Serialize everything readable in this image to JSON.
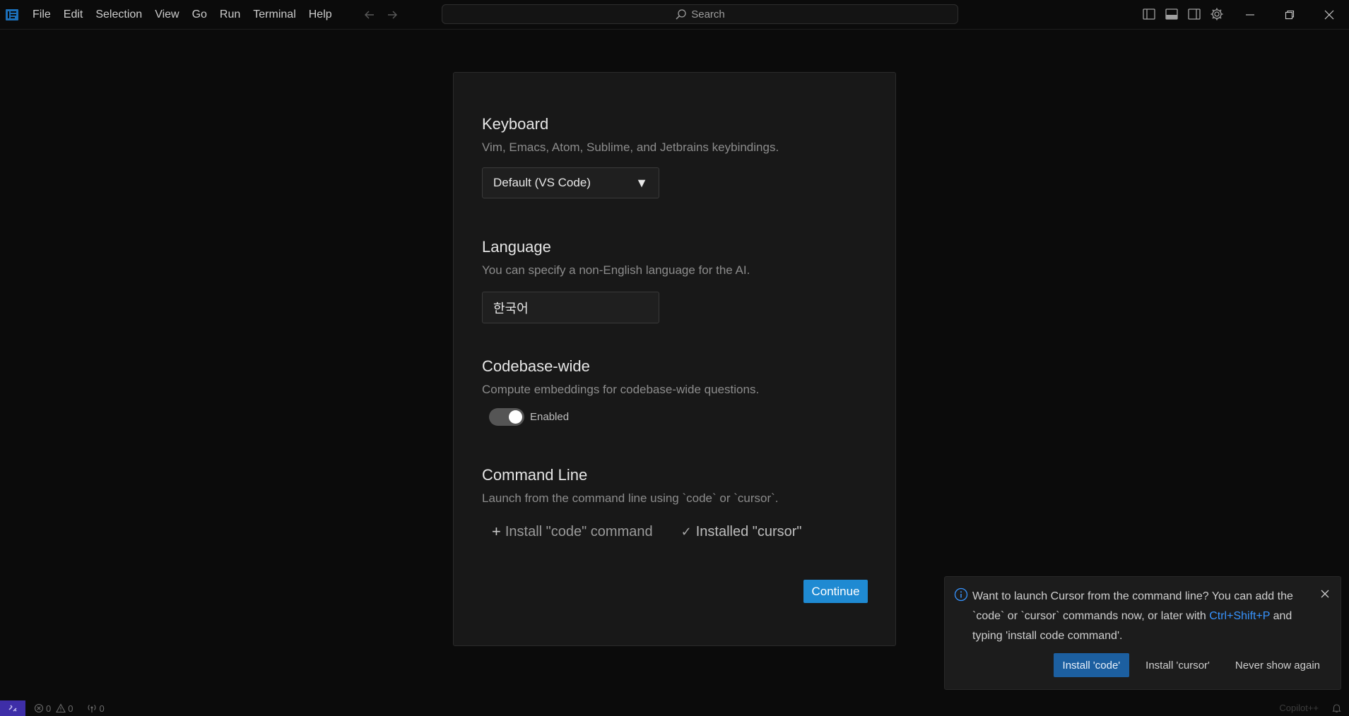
{
  "titlebar": {
    "menu": [
      "File",
      "Edit",
      "Selection",
      "View",
      "Go",
      "Run",
      "Terminal",
      "Help"
    ],
    "search_label": "Search"
  },
  "onboarding": {
    "keyboard": {
      "title": "Keyboard",
      "description": "Vim, Emacs, Atom, Sublime, and Jetbrains keybindings.",
      "selected": "Default (VS Code)"
    },
    "language": {
      "title": "Language",
      "description": "You can specify a non-English language for the AI.",
      "value": "한국어"
    },
    "codebase": {
      "title": "Codebase-wide",
      "description": "Compute embeddings for codebase-wide questions.",
      "toggle_label": "Enabled",
      "enabled": true
    },
    "command_line": {
      "title": "Command Line",
      "description": "Launch from the command line using `code` or `cursor`.",
      "install_code_label": "Install \"code\" command",
      "installed_cursor_label": "Installed \"cursor\""
    },
    "continue_label": "Continue"
  },
  "notification": {
    "text_before": "Want to launch Cursor from the command line? You can add the `code` or `cursor` commands now, or later with ",
    "shortcut": "Ctrl+Shift+P",
    "text_after": " and typing 'install code command'.",
    "actions": [
      "Install 'code'",
      "Install 'cursor'",
      "Never show again"
    ]
  },
  "statusbar": {
    "errors": "0",
    "warnings": "0",
    "ports": "0",
    "right_label": "Copilot++"
  },
  "colors": {
    "accent": "#1f8ad2",
    "notification_primary": "#1c5fa0",
    "remote": "#3e2ea8",
    "link": "#3794ff"
  }
}
